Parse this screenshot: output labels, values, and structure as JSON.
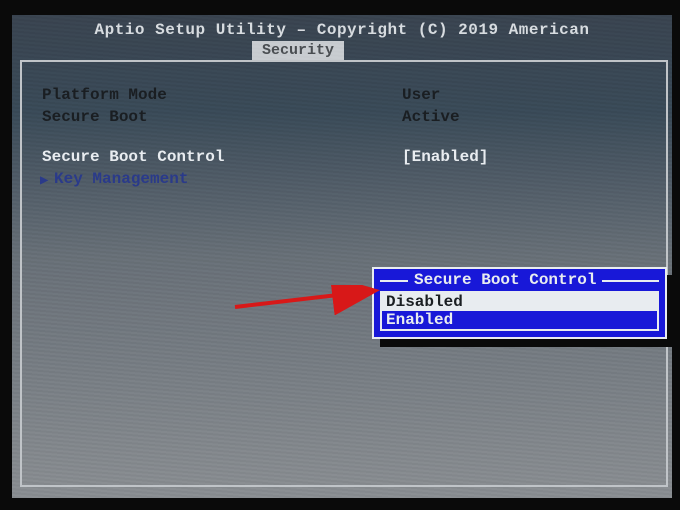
{
  "header": {
    "title": "Aptio Setup Utility – Copyright (C) 2019 American"
  },
  "tabs": {
    "active": "Security"
  },
  "fields": {
    "platform_mode": {
      "label": "Platform Mode",
      "value": "User"
    },
    "secure_boot": {
      "label": "Secure Boot",
      "value": "Active"
    },
    "secure_boot_control": {
      "label": "Secure Boot Control",
      "value": "[Enabled]"
    },
    "key_management": {
      "label": "Key Management"
    }
  },
  "popup": {
    "title": "Secure Boot Control",
    "options": [
      "Disabled",
      "Enabled"
    ],
    "selected": "Disabled"
  },
  "colors": {
    "popup_bg": "#1818d8",
    "highlight_text": "#e8ecf0",
    "menu_blue": "#2a3a8a",
    "arrow": "#d81818"
  }
}
